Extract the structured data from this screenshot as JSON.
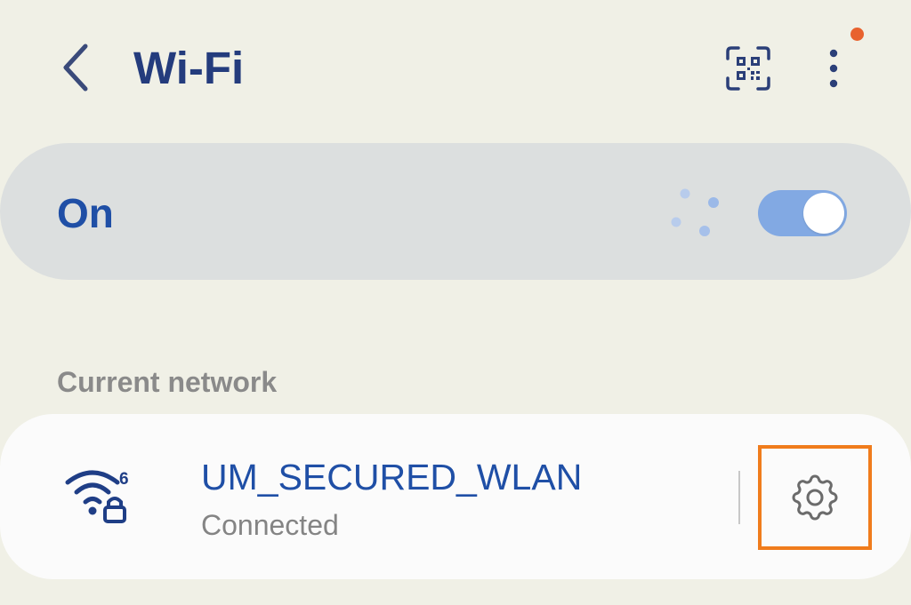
{
  "header": {
    "title": "Wi-Fi",
    "back_icon": "chevron-left-icon",
    "qr_icon": "qr-code-scan-icon",
    "more_icon": "more-vertical-icon",
    "notification_dot": true
  },
  "toggle": {
    "label": "On",
    "state": "on",
    "scanning": true
  },
  "current_network": {
    "section_label": "Current network",
    "name": "UM_SECURED_WLAN",
    "status": "Connected",
    "icon": "wifi-6-secured-icon",
    "settings_icon": "gear-icon",
    "highlighted": "settings-button"
  },
  "colors": {
    "background": "#f0f0e6",
    "title": "#243c7d",
    "accent": "#1f4fa6",
    "switch_track": "#82a9e3",
    "notification": "#e8622e",
    "highlight": "#f07c1c",
    "secondary_text": "#848484"
  }
}
